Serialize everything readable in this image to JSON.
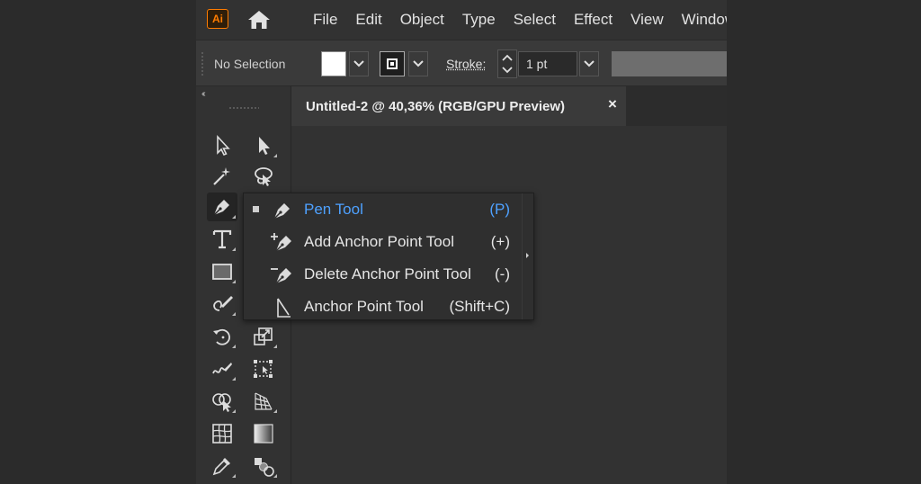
{
  "app": {
    "logo_text": "Ai",
    "accent_color": "#ff7c00",
    "selection_color": "#4ea1ff",
    "icons": [
      "home-icon",
      "selection-arrow-icon",
      "direct-selection-icon",
      "magic-wand-icon",
      "lasso-icon",
      "pen-icon",
      "type-icon",
      "rectangle-icon",
      "paintbrush-icon",
      "rotate-icon",
      "scale-icon",
      "warp-icon",
      "free-transform-icon",
      "shape-builder-icon",
      "perspective-grid-icon",
      "mesh-icon",
      "gradient-icon",
      "eyedropper-icon",
      "blend-icon"
    ]
  },
  "menu": {
    "items": [
      "File",
      "Edit",
      "Object",
      "Type",
      "Select",
      "Effect",
      "View",
      "Window"
    ]
  },
  "control_bar": {
    "selection_label": "No Selection",
    "stroke_label": "Stroke:",
    "stroke_weight": "1 pt",
    "fill_color": "#ffffff"
  },
  "toolbar": {
    "collapse_label": "‹‹"
  },
  "document": {
    "tab_title": "Untitled-2 @ 40,36% (RGB/GPU Preview)",
    "close_glyph": "×"
  },
  "flyout": {
    "items": [
      {
        "label": "Pen Tool",
        "shortcut": "(P)",
        "selected": true
      },
      {
        "label": "Add Anchor Point Tool",
        "shortcut": "(+)",
        "selected": false
      },
      {
        "label": "Delete Anchor Point Tool",
        "shortcut": "(-)",
        "selected": false
      },
      {
        "label": "Anchor Point Tool",
        "shortcut": "(Shift+C)",
        "selected": false
      }
    ]
  }
}
